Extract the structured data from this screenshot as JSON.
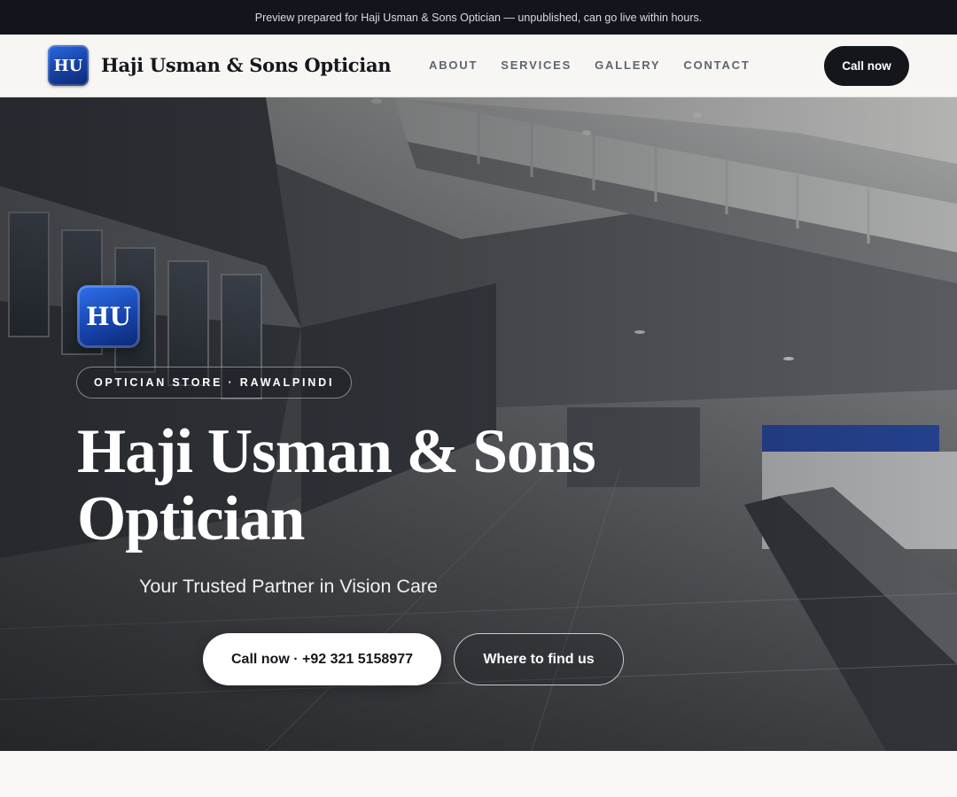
{
  "preview_banner": "Preview prepared for Haji Usman & Sons Optician — unpublished, can go live within hours.",
  "brand": {
    "logo_text": "HU",
    "name": "Haji Usman & Sons Optician"
  },
  "nav": {
    "links": [
      "ABOUT",
      "SERVICES",
      "GALLERY",
      "CONTACT"
    ],
    "cta": "Call now"
  },
  "hero": {
    "logo_text": "HU",
    "badge": "OPTICIAN STORE · RAWALPINDI",
    "title": "Haji Usman & Sons Optician",
    "subtitle": "Your Trusted Partner in Vision Care",
    "primary_button": "Call now · +92 321 5158977",
    "secondary_button": "Where to find us"
  },
  "colors": {
    "dark": "#12151b",
    "logo_blue": "#1744ad",
    "page_background": "#f7f6f3",
    "nav_link": "#5f6470"
  }
}
